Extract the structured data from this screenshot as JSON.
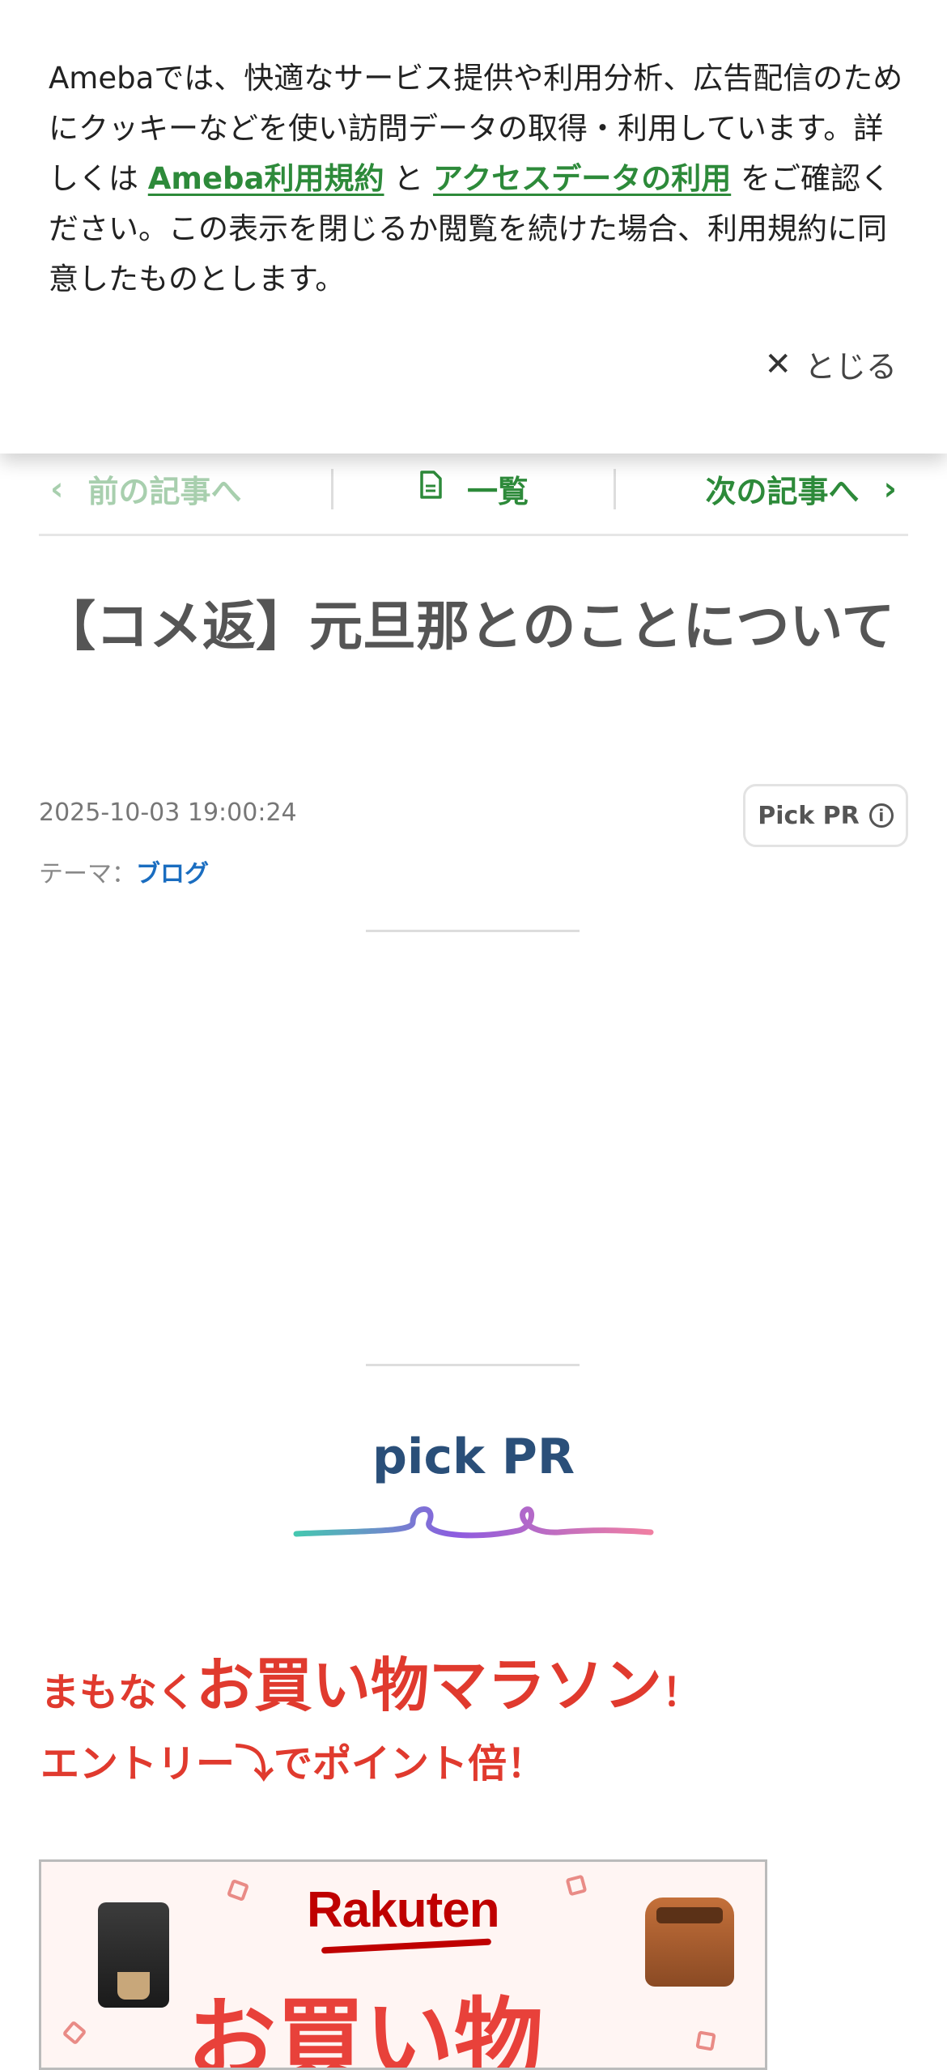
{
  "cookie_banner": {
    "text_before": "Amebaでは、快適なサービス提供や利用分析、広告配信のためにクッキーなどを使い訪問データの取得・利用しています。詳しくは ",
    "link_terms": "Ameba利用規約",
    "text_and": " と ",
    "link_access": "アクセスデータの利用",
    "text_after": " をご確認ください。この表示を閉じるか閲覧を続けた場合、利用規約に同意したものとします。",
    "close_label": "とじる",
    "link_color": "#2d8a3a"
  },
  "article_nav": {
    "prev_label": "前の記事へ",
    "list_label": "一覧",
    "next_label": "次の記事へ"
  },
  "article": {
    "title": "【コメ返】元旦那とのことについて",
    "datetime": "2025-10-03 19:00:24",
    "theme_label": "テーマ：",
    "theme_value": "ブログ",
    "pickpr_button": "Pick PR"
  },
  "pick_pr": {
    "heading": "pick PR",
    "promo_prefix": "まもなく",
    "promo_main": "お買い物マラソン",
    "promo_bang": "！",
    "promo_line2": "エントリー⤵でポイント倍！",
    "banner_logo": "Rakuten",
    "banner_text": "お買い物"
  },
  "colors": {
    "accent_green": "#2d8a3a",
    "promo_red": "#e03a2e",
    "pickpr_blue": "#2a4f79"
  }
}
